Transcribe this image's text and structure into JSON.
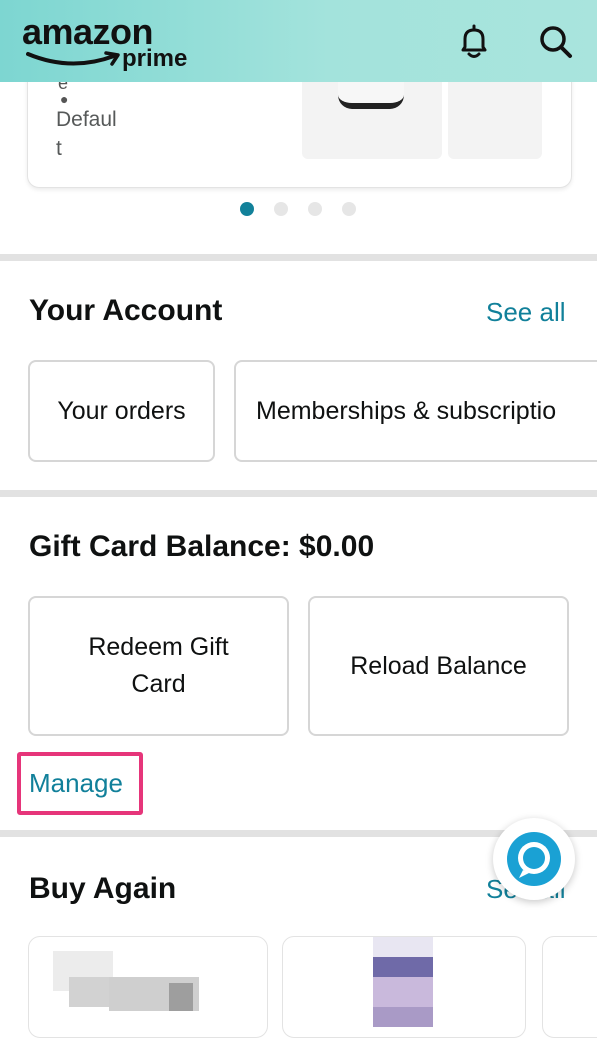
{
  "header": {
    "logo_amazon": "amazon",
    "logo_prime": "prime",
    "notifications_icon": "bell-icon",
    "search_icon": "search-icon",
    "gradient": [
      "#7dd6d1",
      "#a9e4dd"
    ]
  },
  "carousel": {
    "card_text_line1": "e",
    "card_text_line2": "Defaul",
    "card_text_line3": "t",
    "pages": 4,
    "active_page": 1,
    "active_color": "#12819a"
  },
  "your_account": {
    "title": "Your Account",
    "see_all": "See all",
    "buttons": [
      "Your orders",
      "Memberships & subscriptio"
    ]
  },
  "gift_card": {
    "title": "Gift Card Balance: $0.00",
    "buttons": [
      "Redeem Gift Card",
      "Reload Balance"
    ],
    "manage": "Manage",
    "highlight_color": "#e6357a"
  },
  "buy_again": {
    "title": "Buy Again",
    "see_all": "See all"
  },
  "alexa": {
    "icon": "alexa-icon"
  },
  "colors": {
    "link": "#11809a",
    "text": "#0f1111"
  }
}
